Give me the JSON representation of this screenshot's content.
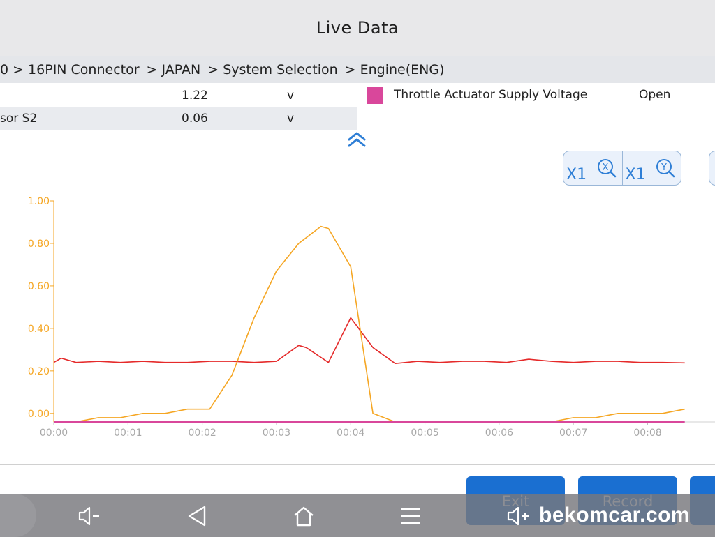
{
  "header": {
    "title": "Live Data"
  },
  "breadcrumb": [
    "0",
    "> 16PIN Connector",
    "> JAPAN",
    "> System Selection",
    "> Engine(ENG)"
  ],
  "rows": [
    {
      "name": "",
      "value": "1.22",
      "unit": "v"
    },
    {
      "name": "sor S2",
      "value": "0.06",
      "unit": "v"
    }
  ],
  "legend": {
    "name": "Throttle Actuator Supply Voltage",
    "status": "Open",
    "color": "#d9479b"
  },
  "zoom": {
    "x_label": "X1",
    "y_label": "X1",
    "x_icon": "X",
    "y_icon": "Y"
  },
  "chart_data": {
    "type": "line",
    "x_ticks": [
      "00:00",
      "00:01",
      "00:02",
      "00:03",
      "00:04",
      "00:05",
      "00:06",
      "00:07",
      "00:08"
    ],
    "y_ticks": [
      "0.00",
      "0.20",
      "0.40",
      "0.60",
      "0.80",
      "1.00"
    ],
    "xlim": [
      0,
      9.2
    ],
    "ylim": [
      -0.04,
      1.0
    ],
    "series": [
      {
        "color": "#e52a2a",
        "x": [
          0,
          0.1,
          0.3,
          0.6,
          0.9,
          1.2,
          1.5,
          1.8,
          2.1,
          2.4,
          2.7,
          3.0,
          3.3,
          3.4,
          3.7,
          4.0,
          4.3,
          4.6,
          4.9,
          5.2,
          5.5,
          5.8,
          6.1,
          6.4,
          6.7,
          7.0,
          7.3,
          7.6,
          7.9,
          8.2,
          8.5
        ],
        "y": [
          0.24,
          0.26,
          0.24,
          0.245,
          0.24,
          0.245,
          0.24,
          0.24,
          0.245,
          0.245,
          0.24,
          0.245,
          0.32,
          0.31,
          0.24,
          0.45,
          0.31,
          0.235,
          0.245,
          0.24,
          0.245,
          0.245,
          0.24,
          0.255,
          0.245,
          0.24,
          0.245,
          0.245,
          0.24,
          0.24,
          0.238
        ]
      },
      {
        "color": "#f5a623",
        "x": [
          0,
          0.3,
          0.6,
          0.9,
          1.2,
          1.5,
          1.8,
          2.1,
          2.4,
          2.7,
          3.0,
          3.3,
          3.6,
          3.7,
          4.0,
          4.3,
          4.6,
          4.9,
          5.2,
          5.5,
          5.8,
          6.1,
          6.4,
          6.7,
          7.0,
          7.3,
          7.6,
          7.9,
          8.2,
          8.5
        ],
        "y": [
          -0.04,
          -0.04,
          -0.02,
          -0.02,
          0.0,
          0.0,
          0.02,
          0.02,
          0.18,
          0.45,
          0.67,
          0.8,
          0.88,
          0.87,
          0.69,
          0.0,
          -0.04,
          -0.04,
          -0.04,
          -0.04,
          -0.04,
          -0.04,
          -0.04,
          -0.04,
          -0.02,
          -0.02,
          0.0,
          0.0,
          0.0,
          0.02
        ]
      },
      {
        "color": "#d9479b",
        "x": [
          0,
          8.5
        ],
        "y": [
          -0.04,
          -0.04
        ]
      }
    ]
  },
  "buttons": {
    "exit": "Exit",
    "record": "Record"
  },
  "watermark": "bekomcar.com"
}
